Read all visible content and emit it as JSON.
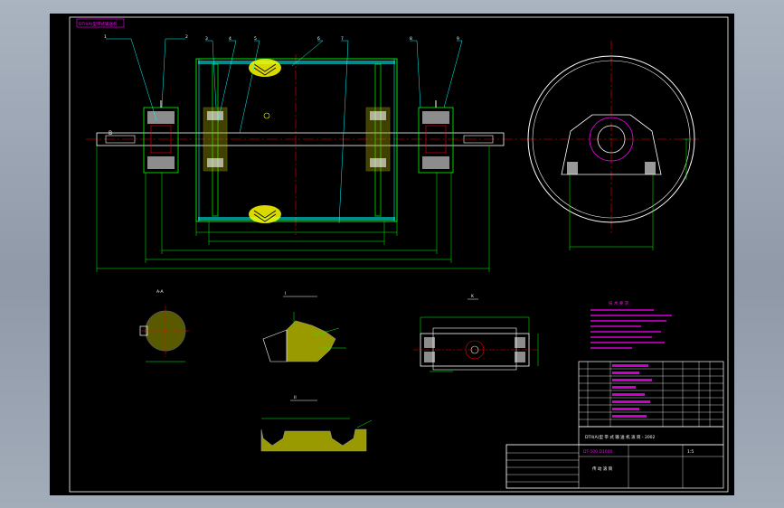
{
  "drawing": {
    "title_tag": "DTII(A)型带式输送机",
    "title_block_header": "DTII(A)型 带 式 输 送 机 滚 筒 - 2002",
    "title_block_drawing_no": "DT-500 D1000",
    "title_block_scale": "1:5",
    "title_block_name": "传 动 滚 筒",
    "notes_title": "技 术 要 求",
    "section_label_a": "A-A",
    "section_label_b": "B",
    "detail_label_1": "I",
    "detail_label_2": "II"
  },
  "colors": {
    "outline": "#00ff00",
    "leaders": "#00ffff",
    "centerline": "#ff0000",
    "dimension": "#00ff00",
    "hatch": "#ffff00",
    "shaft": "#ffffff",
    "notes": "#ff00ff",
    "frame": "#ffffff"
  }
}
